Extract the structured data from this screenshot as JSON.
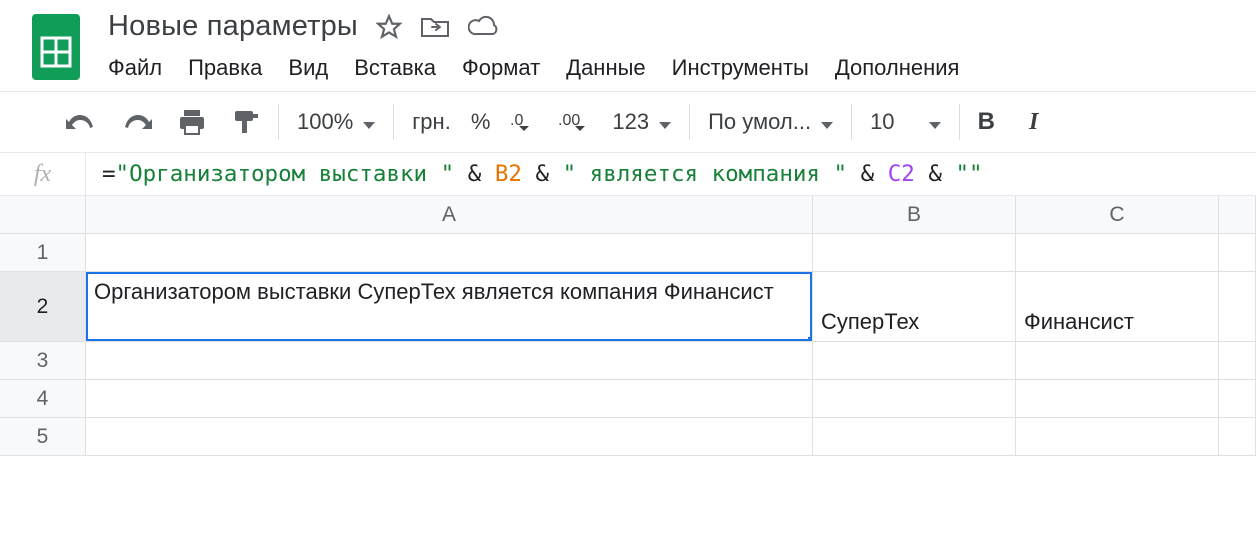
{
  "header": {
    "title": "Новые параметры"
  },
  "menubar": {
    "file": "Файл",
    "edit": "Правка",
    "view": "Вид",
    "insert": "Вставка",
    "format": "Формат",
    "data": "Данные",
    "tools": "Инструменты",
    "addons": "Дополнения"
  },
  "toolbar": {
    "zoom": "100%",
    "currency": "грн.",
    "percent": "%",
    "numfmt": "123",
    "font": "По умол...",
    "fontsize": "10"
  },
  "formula": {
    "fx": "fx",
    "eq": "=",
    "str1": "\"Организатором выставки \"",
    "amp": " & ",
    "ref1": "B2",
    "str2": "\" является компания \"",
    "ref2": "C2",
    "str3": "\"\""
  },
  "grid": {
    "cols": {
      "A": "A",
      "B": "B",
      "C": "C"
    },
    "rows": {
      "r1": "1",
      "r2": "2",
      "r3": "3",
      "r4": "4",
      "r5": "5"
    },
    "cells": {
      "A2": "Организатором выставки СуперТех является компания Финансист",
      "B2": "СуперТех",
      "C2": "Финансист"
    }
  }
}
